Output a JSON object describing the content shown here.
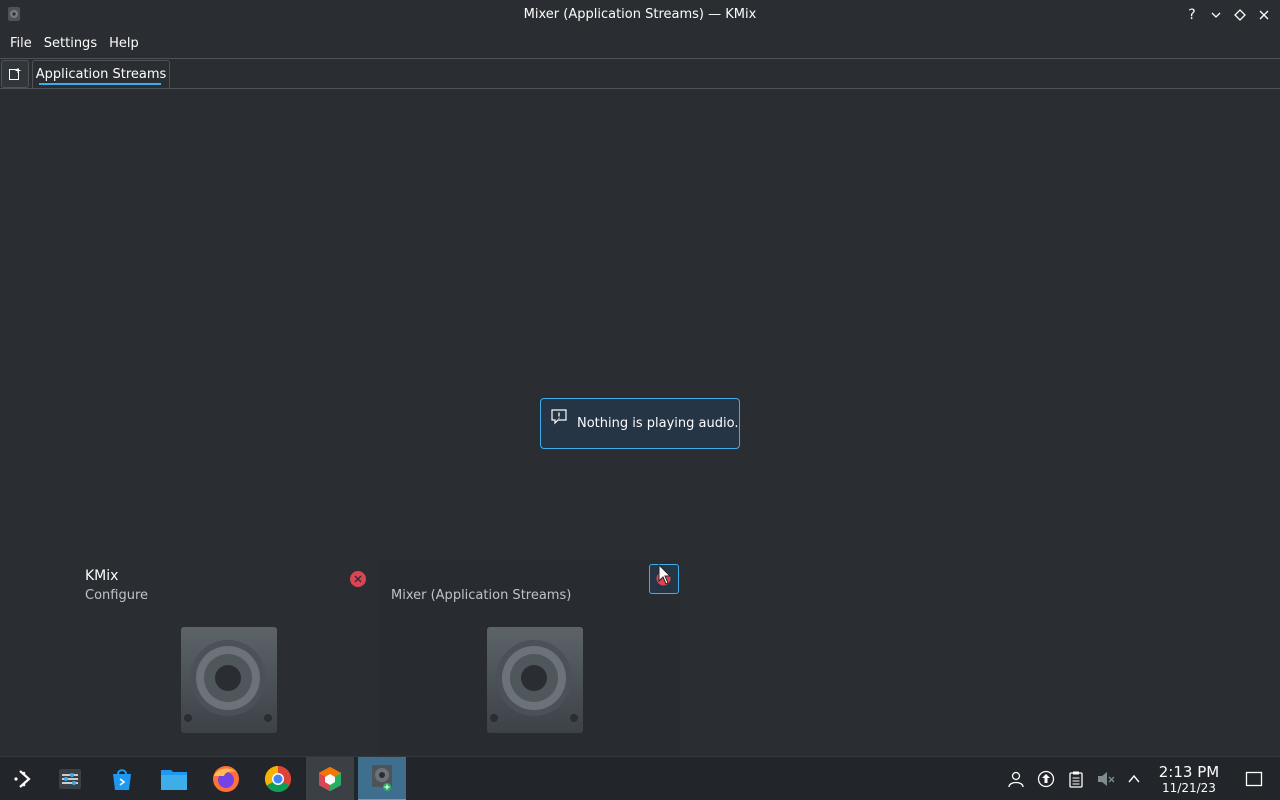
{
  "window": {
    "title": "Mixer (Application Streams) — KMix"
  },
  "menubar": {
    "items": [
      "File",
      "Settings",
      "Help"
    ]
  },
  "tabs": {
    "items": [
      {
        "label": "Application Streams"
      }
    ]
  },
  "content": {
    "message": "Nothing is playing audio."
  },
  "previews": [
    {
      "title": "KMix",
      "subtitle": "Configure"
    },
    {
      "title": "",
      "subtitle": "Mixer (Application Streams)"
    }
  ],
  "taskbar": {
    "apps": [
      "application-launcher-icon",
      "settings-icon",
      "discover-icon",
      "dolphin-icon",
      "firefox-icon",
      "chrome-icon",
      "app-icon",
      "kmix-icon"
    ],
    "clock": {
      "time": "2:13 PM",
      "date": "11/21/23"
    }
  },
  "colors": {
    "accent": "#3daee9",
    "background": "#2a2e32",
    "close": "#da4453"
  }
}
